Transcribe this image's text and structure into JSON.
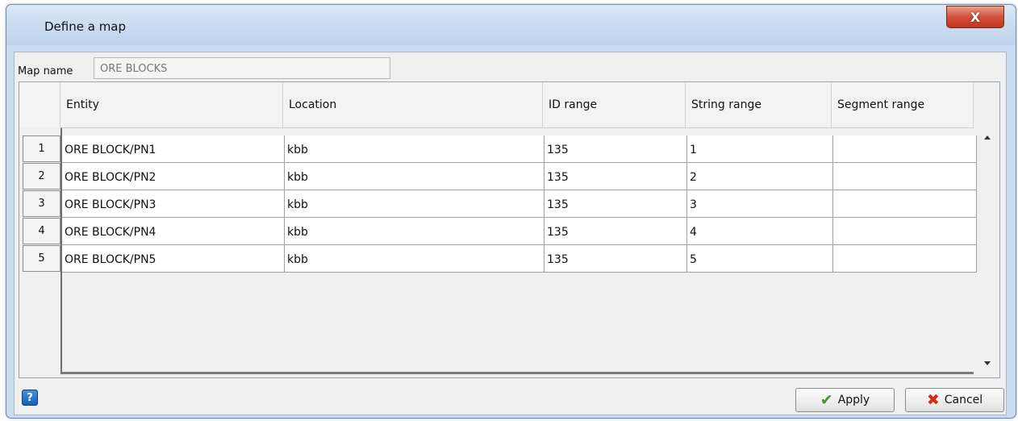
{
  "window": {
    "title": "Define a map",
    "close_glyph": "X"
  },
  "map_name": {
    "label": "Map name",
    "value": "ORE BLOCKS"
  },
  "table": {
    "columns": [
      "Entity",
      "Location",
      "ID range",
      "String range",
      "Segment range"
    ],
    "rows": [
      {
        "num": "1",
        "entity": "ORE BLOCK/PN1",
        "location": "kbb",
        "id_range": "135",
        "string_range": "1",
        "segment_range": ""
      },
      {
        "num": "2",
        "entity": "ORE BLOCK/PN2",
        "location": "kbb",
        "id_range": "135",
        "string_range": "2",
        "segment_range": ""
      },
      {
        "num": "3",
        "entity": "ORE BLOCK/PN3",
        "location": "kbb",
        "id_range": "135",
        "string_range": "3",
        "segment_range": ""
      },
      {
        "num": "4",
        "entity": "ORE BLOCK/PN4",
        "location": "kbb",
        "id_range": "135",
        "string_range": "4",
        "segment_range": ""
      },
      {
        "num": "5",
        "entity": "ORE BLOCK/PN5",
        "location": "kbb",
        "id_range": "135",
        "string_range": "5",
        "segment_range": ""
      }
    ]
  },
  "footer": {
    "help_icon": "help-icon",
    "help_glyph": "?",
    "apply_label": "Apply",
    "cancel_label": "Cancel",
    "apply_icon": "check-icon",
    "cancel_icon": "x-icon"
  },
  "colors": {
    "title_bar": "#c9dcf1",
    "close_button": "#c7402b",
    "help_button": "#1e6fd0"
  }
}
